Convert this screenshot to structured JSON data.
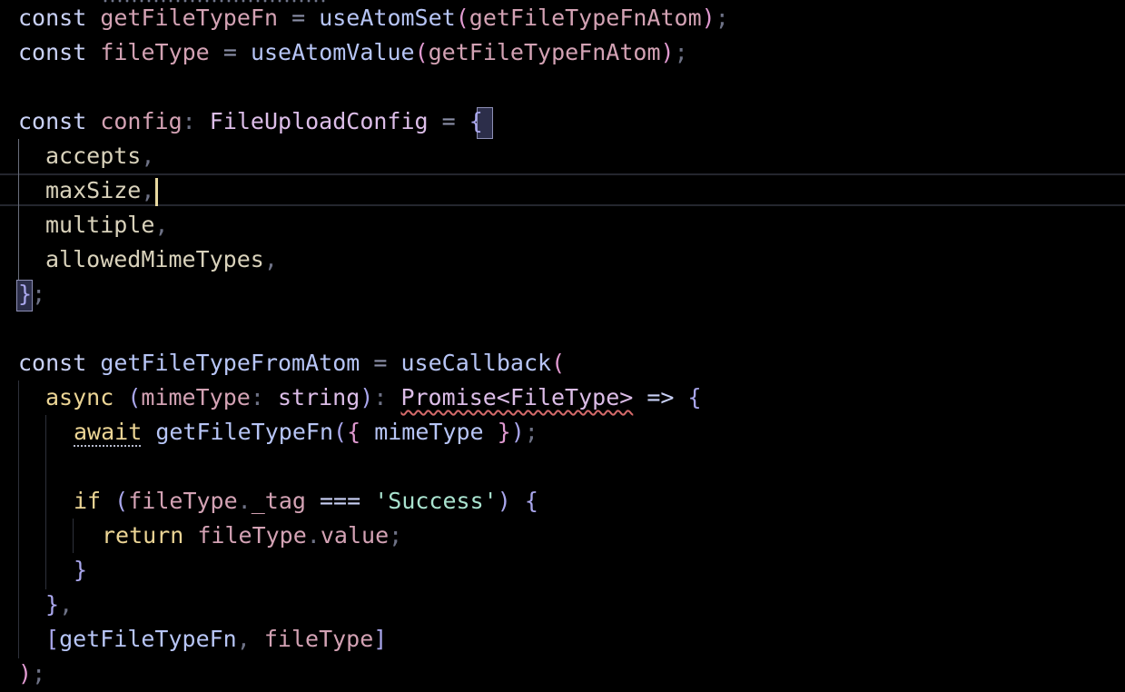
{
  "editor": {
    "theme_colors": {
      "background": "#000000",
      "keyword": "#c9d1f6",
      "variable": "#d3a2b4",
      "function": "#b7c5f6",
      "type": "#dcbde8",
      "string": "#a9e3cf",
      "control": "#ecd595",
      "cursor": "#e8d9a0",
      "error_squiggle": "#d66a6a"
    },
    "lines": {
      "l1": {
        "kw": "const",
        "name": "getFileTypeFn",
        "eq": "=",
        "fn": "useAtomSet",
        "open": "(",
        "arg": "getFileTypeFnAtom",
        "close": ")",
        "semi": ";"
      },
      "l2": {
        "kw": "const",
        "name": "fileType",
        "eq": "=",
        "fn": "useAtomValue",
        "open": "(",
        "arg": "getFileTypeFnAtom",
        "close": ")",
        "semi": ";"
      },
      "l4": {
        "kw": "const",
        "name": "config",
        "colon": ":",
        "type": "FileUploadConfig",
        "eq": "=",
        "brace": "{"
      },
      "l5": {
        "prop": "accepts",
        "comma": ","
      },
      "l6": {
        "prop": "maxSize",
        "comma": ","
      },
      "l7": {
        "prop": "multiple",
        "comma": ","
      },
      "l8": {
        "prop": "allowedMimeTypes",
        "comma": ","
      },
      "l9": {
        "brace": "}",
        "semi": ";"
      },
      "l11": {
        "kw": "const",
        "name": "getFileTypeFromAtom",
        "eq": "=",
        "fn": "useCallback",
        "open": "("
      },
      "l12": {
        "async": "async",
        "open": "(",
        "param": "mimeType",
        "colon": ":",
        "ptype": "string",
        "close": ")",
        "colon2": ":",
        "promise": "Promise<FileType>",
        "arrow": "=>",
        "brace": "{"
      },
      "l13": {
        "await": "await",
        "fn": "getFileTypeFn",
        "open": "(",
        "brace_open": "{",
        "arg": "mimeType",
        "brace_close": "}",
        "close": ")",
        "semi": ";"
      },
      "l15": {
        "if": "if",
        "open": "(",
        "obj": "fileType",
        "dot": ".",
        "prop": "_tag",
        "op": "===",
        "str": "'Success'",
        "close": ")",
        "brace": "{"
      },
      "l16": {
        "ret": "return",
        "obj": "fileType",
        "dot": ".",
        "prop": "value",
        "semi": ";"
      },
      "l17": {
        "brace": "}"
      },
      "l18": {
        "brace": "}",
        "comma": ","
      },
      "l19": {
        "open": "[",
        "a": "getFileTypeFn",
        "comma": ",",
        "b": "fileType",
        "close": "]"
      },
      "l20": {
        "close": ")",
        "semi": ";"
      }
    }
  }
}
